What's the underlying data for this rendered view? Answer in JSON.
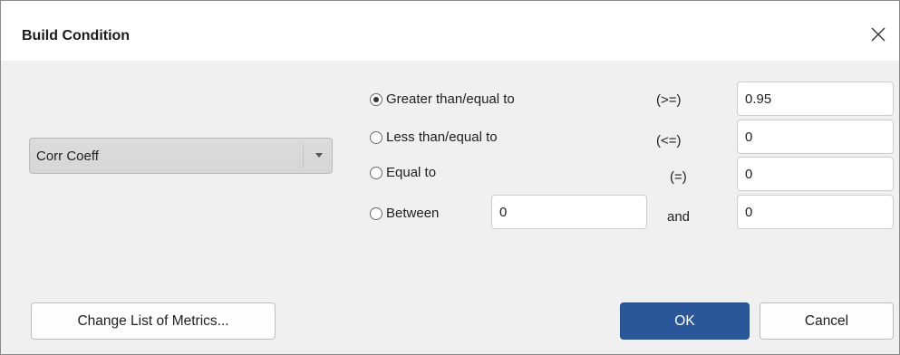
{
  "window": {
    "title": "Build Condition"
  },
  "metric_select": {
    "selected": "Corr Coeff"
  },
  "conditions": [
    {
      "label": "Greater than/equal to",
      "symbol": "(>=)",
      "value": "0.95",
      "checked": true
    },
    {
      "label": "Less than/equal to",
      "symbol": "(<=)",
      "value": "0",
      "checked": false
    },
    {
      "label": "Equal to",
      "symbol": "(=)",
      "value": "0",
      "checked": false
    },
    {
      "label": "Between",
      "from_value": "0",
      "and_label": "and",
      "value": "0",
      "checked": false
    }
  ],
  "buttons": {
    "change_metrics": "Change List of Metrics...",
    "ok": "OK",
    "cancel": "Cancel"
  },
  "icons": {
    "close": "close-icon",
    "dropdown": "chevron-down-icon"
  },
  "colors": {
    "primary_button": "#2b579a",
    "titlebar": "#ffffff",
    "dialog_bg": "#f0f0f0"
  }
}
